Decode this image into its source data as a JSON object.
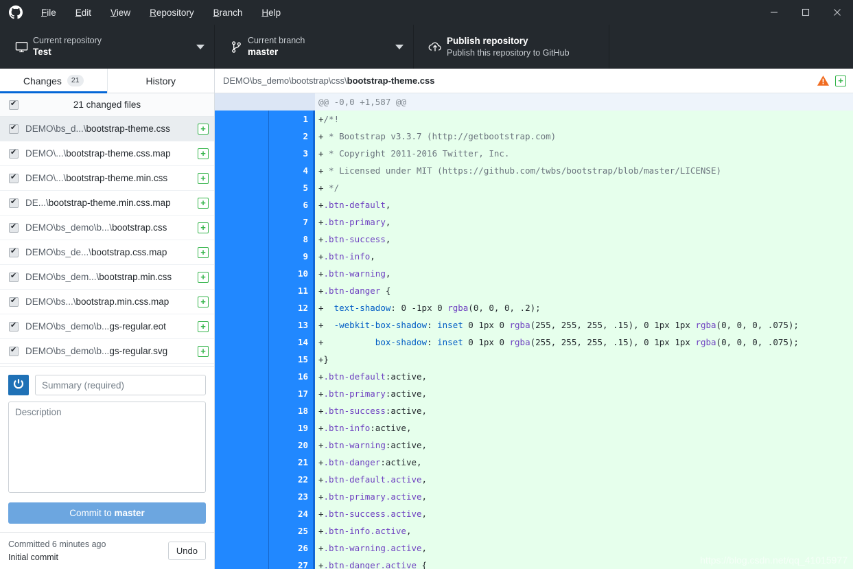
{
  "titlebar": {
    "logo_icon": "github-mark-icon",
    "menu": [
      {
        "label": "File",
        "accel": "F"
      },
      {
        "label": "Edit",
        "accel": "E"
      },
      {
        "label": "View",
        "accel": "V"
      },
      {
        "label": "Repository",
        "accel": "R"
      },
      {
        "label": "Branch",
        "accel": "B"
      },
      {
        "label": "Help",
        "accel": "H"
      }
    ],
    "window_controls": {
      "minimize": "minimize-icon",
      "maximize": "maximize-icon",
      "close": "close-icon"
    }
  },
  "toolbar": {
    "repository": {
      "icon": "monitor-icon",
      "label": "Current repository",
      "value": "Test",
      "caret": "chevron-down-icon"
    },
    "branch": {
      "icon": "branch-icon",
      "label": "Current branch",
      "value": "master",
      "caret": "chevron-down-icon"
    },
    "publish": {
      "icon": "cloud-upload-icon",
      "title": "Publish repository",
      "subtitle": "Publish this repository to GitHub"
    }
  },
  "sidebar": {
    "tabs": [
      {
        "label": "Changes",
        "badge": "21",
        "active": true
      },
      {
        "label": "History",
        "badge": "",
        "active": false
      }
    ],
    "all_files_label": "21 changed files",
    "all_files_checked": true,
    "files": [
      {
        "prefix": "DEMO\\bs_d...\\",
        "name": "bootstrap-theme.css",
        "status": "+",
        "checked": true,
        "selected": true
      },
      {
        "prefix": "DEMO\\...\\",
        "name": "bootstrap-theme.css.map",
        "status": "+",
        "checked": true,
        "selected": false
      },
      {
        "prefix": "DEMO\\...\\",
        "name": "bootstrap-theme.min.css",
        "status": "+",
        "checked": true,
        "selected": false
      },
      {
        "prefix": "DE...\\",
        "name": "bootstrap-theme.min.css.map",
        "status": "+",
        "checked": true,
        "selected": false
      },
      {
        "prefix": "DEMO\\bs_demo\\b...\\",
        "name": "bootstrap.css",
        "status": "+",
        "checked": true,
        "selected": false
      },
      {
        "prefix": "DEMO\\bs_de...\\",
        "name": "bootstrap.css.map",
        "status": "+",
        "checked": true,
        "selected": false
      },
      {
        "prefix": "DEMO\\bs_dem...\\",
        "name": "bootstrap.min.css",
        "status": "+",
        "checked": true,
        "selected": false
      },
      {
        "prefix": "DEMO\\bs...\\",
        "name": "bootstrap.min.css.map",
        "status": "+",
        "checked": true,
        "selected": false
      },
      {
        "prefix": "DEMO\\bs_demo\\b...",
        "name": "gs-regular.eot",
        "status": "+",
        "checked": true,
        "selected": false
      },
      {
        "prefix": "DEMO\\bs_demo\\b...",
        "name": "gs-regular.svg",
        "status": "+",
        "checked": true,
        "selected": false
      }
    ],
    "commit": {
      "avatar_icon": "user-avatar-icon",
      "summary_value": "",
      "summary_placeholder": "Summary (required)",
      "description_value": "",
      "description_placeholder": "Description",
      "button_prefix": "Commit to ",
      "button_branch": "master"
    },
    "undo_bar": {
      "committed_text": "Committed 6 minutes ago",
      "commit_message": "Initial commit",
      "undo_label": "Undo"
    }
  },
  "diff": {
    "header": {
      "path_prefix": "DEMO\\bs_demo\\bootstrap\\css\\",
      "file_name": "bootstrap-theme.css",
      "warning_icon": "warning-triangle-icon",
      "status_icon": "added-plus-icon"
    },
    "hunk_header": "@@ -0,0 +1,587 @@",
    "lines": [
      {
        "n": "1",
        "tokens": [
          {
            "t": "+",
            "c": "plus"
          },
          {
            "t": "/*!",
            "c": "com"
          }
        ]
      },
      {
        "n": "2",
        "tokens": [
          {
            "t": "+",
            "c": "plus"
          },
          {
            "t": " * Bootstrap v3.3.7 (http://getbootstrap.com)",
            "c": "com"
          }
        ]
      },
      {
        "n": "3",
        "tokens": [
          {
            "t": "+",
            "c": "plus"
          },
          {
            "t": " * Copyright 2011-2016 Twitter, Inc.",
            "c": "com"
          }
        ]
      },
      {
        "n": "4",
        "tokens": [
          {
            "t": "+",
            "c": "plus"
          },
          {
            "t": " * Licensed under MIT (https://github.com/twbs/bootstrap/blob/master/LICENSE)",
            "c": "com"
          }
        ]
      },
      {
        "n": "5",
        "tokens": [
          {
            "t": "+",
            "c": "plus"
          },
          {
            "t": " */",
            "c": "com"
          }
        ]
      },
      {
        "n": "6",
        "tokens": [
          {
            "t": "+",
            "c": "plus"
          },
          {
            "t": ".btn-default",
            "c": "sel"
          },
          {
            "t": ",",
            "c": "pln"
          }
        ]
      },
      {
        "n": "7",
        "tokens": [
          {
            "t": "+",
            "c": "plus"
          },
          {
            "t": ".btn-primary",
            "c": "sel"
          },
          {
            "t": ",",
            "c": "pln"
          }
        ]
      },
      {
        "n": "8",
        "tokens": [
          {
            "t": "+",
            "c": "plus"
          },
          {
            "t": ".btn-success",
            "c": "sel"
          },
          {
            "t": ",",
            "c": "pln"
          }
        ]
      },
      {
        "n": "9",
        "tokens": [
          {
            "t": "+",
            "c": "plus"
          },
          {
            "t": ".btn-info",
            "c": "sel"
          },
          {
            "t": ",",
            "c": "pln"
          }
        ]
      },
      {
        "n": "10",
        "tokens": [
          {
            "t": "+",
            "c": "plus"
          },
          {
            "t": ".btn-warning",
            "c": "sel"
          },
          {
            "t": ",",
            "c": "pln"
          }
        ]
      },
      {
        "n": "11",
        "tokens": [
          {
            "t": "+",
            "c": "plus"
          },
          {
            "t": ".btn-danger",
            "c": "sel"
          },
          {
            "t": " {",
            "c": "pln"
          }
        ]
      },
      {
        "n": "12",
        "tokens": [
          {
            "t": "+",
            "c": "plus"
          },
          {
            "t": "  ",
            "c": "pln"
          },
          {
            "t": "text-shadow",
            "c": "prop"
          },
          {
            "t": ": 0 -1px 0 ",
            "c": "pln"
          },
          {
            "t": "rgba",
            "c": "fn"
          },
          {
            "t": "(0, 0, 0, .2);",
            "c": "pln"
          }
        ]
      },
      {
        "n": "13",
        "tokens": [
          {
            "t": "+",
            "c": "plus"
          },
          {
            "t": "  ",
            "c": "pln"
          },
          {
            "t": "-webkit-box-shadow",
            "c": "prop"
          },
          {
            "t": ": ",
            "c": "pln"
          },
          {
            "t": "inset",
            "c": "prop"
          },
          {
            "t": " 0 1px 0 ",
            "c": "pln"
          },
          {
            "t": "rgba",
            "c": "fn"
          },
          {
            "t": "(255, 255, 255, .15), 0 1px 1px ",
            "c": "pln"
          },
          {
            "t": "rgba",
            "c": "fn"
          },
          {
            "t": "(0, 0, 0, .075);",
            "c": "pln"
          }
        ]
      },
      {
        "n": "14",
        "tokens": [
          {
            "t": "+",
            "c": "plus"
          },
          {
            "t": "          ",
            "c": "pln"
          },
          {
            "t": "box-shadow",
            "c": "prop"
          },
          {
            "t": ": ",
            "c": "pln"
          },
          {
            "t": "inset",
            "c": "prop"
          },
          {
            "t": " 0 1px 0 ",
            "c": "pln"
          },
          {
            "t": "rgba",
            "c": "fn"
          },
          {
            "t": "(255, 255, 255, .15), 0 1px 1px ",
            "c": "pln"
          },
          {
            "t": "rgba",
            "c": "fn"
          },
          {
            "t": "(0, 0, 0, .075);",
            "c": "pln"
          }
        ]
      },
      {
        "n": "15",
        "tokens": [
          {
            "t": "+",
            "c": "plus"
          },
          {
            "t": "}",
            "c": "pln"
          }
        ]
      },
      {
        "n": "16",
        "tokens": [
          {
            "t": "+",
            "c": "plus"
          },
          {
            "t": ".btn-default",
            "c": "sel"
          },
          {
            "t": ":active,",
            "c": "pln"
          }
        ]
      },
      {
        "n": "17",
        "tokens": [
          {
            "t": "+",
            "c": "plus"
          },
          {
            "t": ".btn-primary",
            "c": "sel"
          },
          {
            "t": ":active,",
            "c": "pln"
          }
        ]
      },
      {
        "n": "18",
        "tokens": [
          {
            "t": "+",
            "c": "plus"
          },
          {
            "t": ".btn-success",
            "c": "sel"
          },
          {
            "t": ":active,",
            "c": "pln"
          }
        ]
      },
      {
        "n": "19",
        "tokens": [
          {
            "t": "+",
            "c": "plus"
          },
          {
            "t": ".btn-info",
            "c": "sel"
          },
          {
            "t": ":active,",
            "c": "pln"
          }
        ]
      },
      {
        "n": "20",
        "tokens": [
          {
            "t": "+",
            "c": "plus"
          },
          {
            "t": ".btn-warning",
            "c": "sel"
          },
          {
            "t": ":active,",
            "c": "pln"
          }
        ]
      },
      {
        "n": "21",
        "tokens": [
          {
            "t": "+",
            "c": "plus"
          },
          {
            "t": ".btn-danger",
            "c": "sel"
          },
          {
            "t": ":active,",
            "c": "pln"
          }
        ]
      },
      {
        "n": "22",
        "tokens": [
          {
            "t": "+",
            "c": "plus"
          },
          {
            "t": ".btn-default.active",
            "c": "sel"
          },
          {
            "t": ",",
            "c": "pln"
          }
        ]
      },
      {
        "n": "23",
        "tokens": [
          {
            "t": "+",
            "c": "plus"
          },
          {
            "t": ".btn-primary.active",
            "c": "sel"
          },
          {
            "t": ",",
            "c": "pln"
          }
        ]
      },
      {
        "n": "24",
        "tokens": [
          {
            "t": "+",
            "c": "plus"
          },
          {
            "t": ".btn-success.active",
            "c": "sel"
          },
          {
            "t": ",",
            "c": "pln"
          }
        ]
      },
      {
        "n": "25",
        "tokens": [
          {
            "t": "+",
            "c": "plus"
          },
          {
            "t": ".btn-info.active",
            "c": "sel"
          },
          {
            "t": ",",
            "c": "pln"
          }
        ]
      },
      {
        "n": "26",
        "tokens": [
          {
            "t": "+",
            "c": "plus"
          },
          {
            "t": ".btn-warning.active",
            "c": "sel"
          },
          {
            "t": ",",
            "c": "pln"
          }
        ]
      },
      {
        "n": "27",
        "tokens": [
          {
            "t": "+",
            "c": "plus"
          },
          {
            "t": ".btn-danger.active",
            "c": "sel"
          },
          {
            "t": " {",
            "c": "pln"
          }
        ]
      }
    ]
  },
  "watermark": "https://blog.csdn.net/qq_41015977",
  "colors": {
    "chrome_bg": "#24292e",
    "accent_blue": "#0366d6",
    "diff_add_bg": "#e6ffec",
    "diff_gutter": "#2188ff",
    "status_green": "#34b44a",
    "warning_orange": "#f06c21"
  }
}
